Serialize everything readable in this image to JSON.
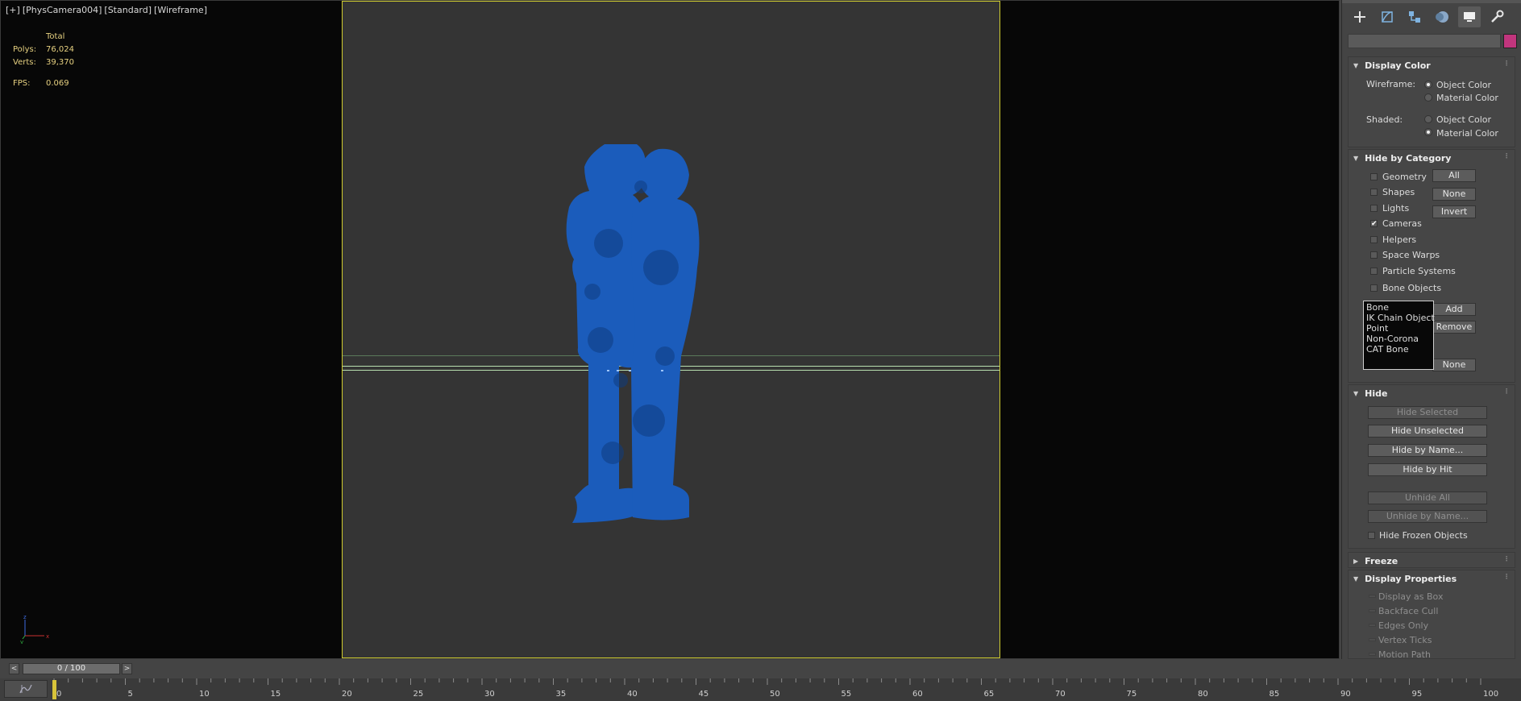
{
  "viewport": {
    "labels": [
      "[+]",
      "[PhysCamera004]",
      "[Standard]",
      "[Wireframe]"
    ],
    "stats": {
      "header": "Total",
      "rows": [
        {
          "key": "Polys:",
          "value": "76,024"
        },
        {
          "key": "Verts:",
          "value": "39,370"
        }
      ],
      "fps_key": "FPS:",
      "fps_value": "0.069"
    },
    "model_color": "#1b5cbb",
    "safe_frame_color": "#cfcc30"
  },
  "command_panel": {
    "tabs": [
      "create-icon",
      "modify-icon",
      "hierarchy-icon",
      "motion-icon",
      "display-icon",
      "utilities-icon"
    ],
    "active_tab": "display-icon",
    "name_field": "",
    "object_color": "#c1357d",
    "display_color": {
      "title": "Display Color",
      "wireframe_label": "Wireframe:",
      "shaded_label": "Shaded:",
      "object_color": "Object Color",
      "material_color": "Material Color",
      "wireframe_selected": "Object Color",
      "shaded_selected": "Material Color"
    },
    "hide_by_category": {
      "title": "Hide by Category",
      "categories": [
        {
          "label": "Geometry",
          "checked": false
        },
        {
          "label": "Shapes",
          "checked": false
        },
        {
          "label": "Lights",
          "checked": false
        },
        {
          "label": "Cameras",
          "checked": true
        },
        {
          "label": "Helpers",
          "checked": false
        },
        {
          "label": "Space Warps",
          "checked": false
        },
        {
          "label": "Particle Systems",
          "checked": false
        },
        {
          "label": "Bone Objects",
          "checked": false
        }
      ],
      "all_btn": "All",
      "none_btn": "None",
      "invert_btn": "Invert",
      "list_items": [
        "Bone",
        "IK Chain Object",
        "Point",
        "Non-Corona",
        "CAT Bone"
      ],
      "add_btn": "Add",
      "remove_btn": "Remove",
      "none_btn_2": "None"
    },
    "hide": {
      "title": "Hide",
      "hide_selected": "Hide Selected",
      "hide_unselected": "Hide Unselected",
      "hide_by_name": "Hide by Name...",
      "hide_by_hit": "Hide by Hit",
      "unhide_all": "Unhide All",
      "unhide_by_name": "Unhide by Name...",
      "hide_frozen": "Hide Frozen Objects"
    },
    "freeze": {
      "title": "Freeze"
    },
    "display_properties": {
      "title": "Display Properties",
      "items": [
        "Display as Box",
        "Backface Cull",
        "Edges Only",
        "Vertex Ticks",
        "Motion Path"
      ]
    }
  },
  "timeline": {
    "slider_label": "0 / 100",
    "prev": "<",
    "next": ">",
    "current_frame": 0,
    "total_frames": 100,
    "tick_labels": [
      "0",
      "5",
      "10",
      "15",
      "20",
      "25",
      "30",
      "35",
      "40",
      "45",
      "50",
      "55",
      "60",
      "65",
      "70",
      "75",
      "80",
      "85",
      "90",
      "95",
      "100"
    ]
  }
}
